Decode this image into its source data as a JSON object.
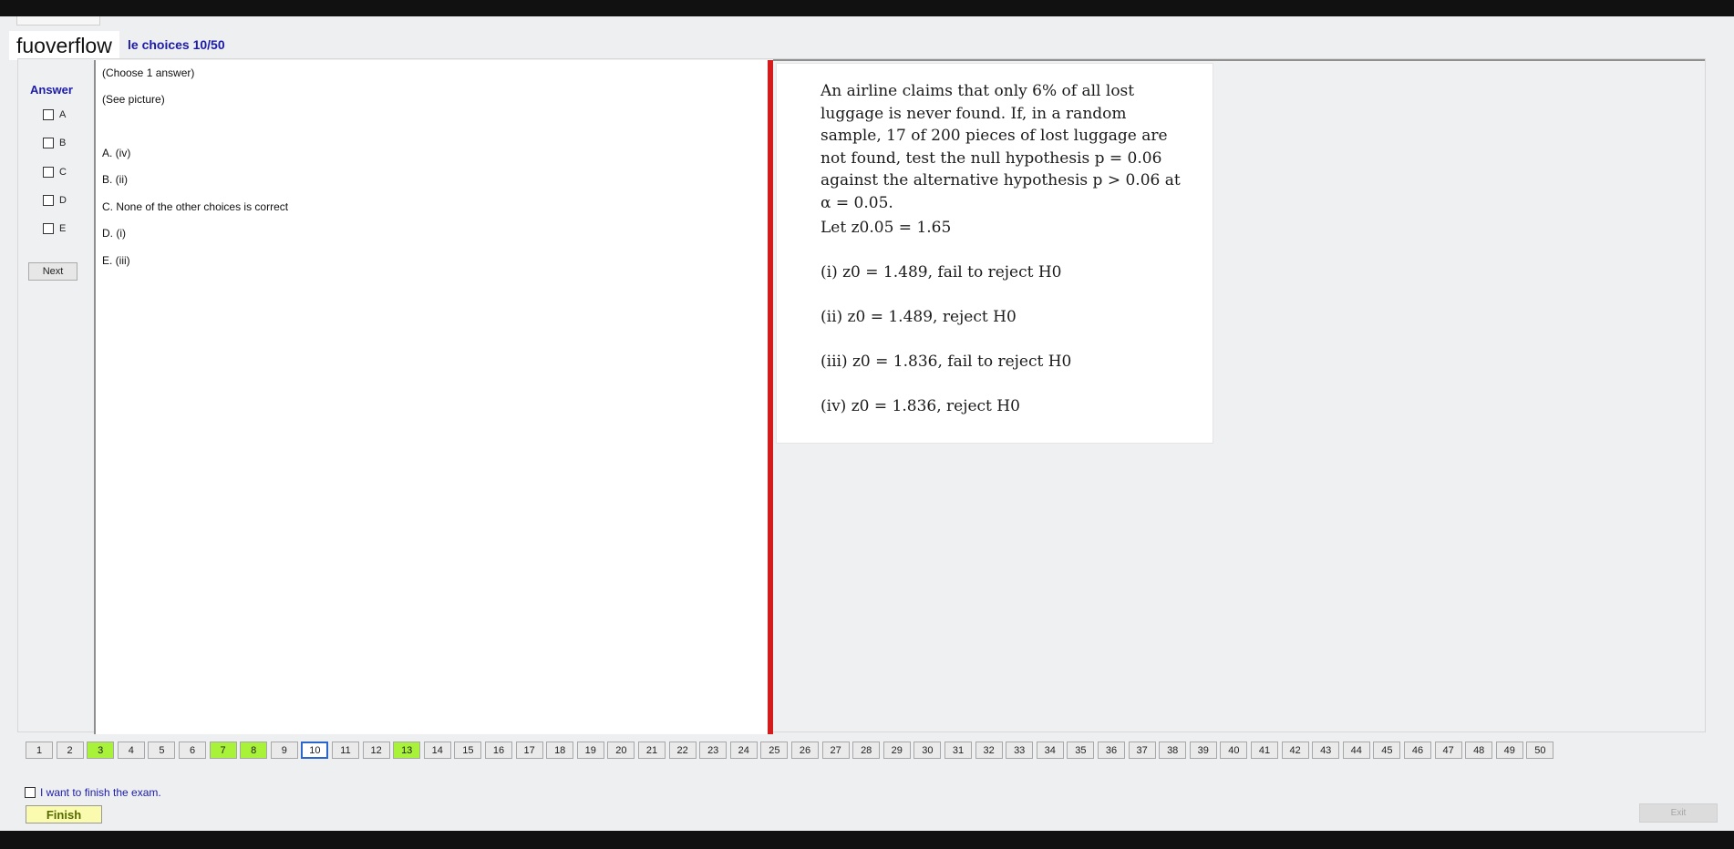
{
  "brand": {
    "logo": "fuoverflow"
  },
  "header": {
    "title": "le choices 10/50"
  },
  "answer_panel": {
    "title": "Answer",
    "options": [
      "A",
      "B",
      "C",
      "D",
      "E"
    ],
    "next_label": "Next"
  },
  "question": {
    "instruction": "(Choose 1 answer)",
    "prompt": "(See picture)",
    "choices": [
      "A.  (iv)",
      "B.  (ii)",
      "C.  None of the other choices is correct",
      "D.  (i)",
      "E.  (iii)"
    ]
  },
  "problem_image": {
    "paragraph": "An airline claims that only 6% of all lost luggage is never found. If, in a random sample, 17 of 200 pieces of lost luggage are not found, test the null hypothesis p = 0.06 against the alternative hypothesis p > 0.06 at α = 0.05.",
    "z_line": "Let z0.05 = 1.65",
    "options": [
      "(i) z0 = 1.489, fail to reject H0",
      "(ii) z0 = 1.489, reject H0",
      "(iii) z0 = 1.836, fail to reject H0",
      "(iv) z0 = 1.836, reject H0"
    ]
  },
  "navigation": {
    "total": 50,
    "current": 10,
    "answered": [
      3,
      7,
      8,
      13
    ],
    "labels": [
      "1",
      "2",
      "3",
      "4",
      "5",
      "6",
      "7",
      "8",
      "9",
      "10",
      "11",
      "12",
      "13",
      "14",
      "15",
      "16",
      "17",
      "18",
      "19",
      "20",
      "21",
      "22",
      "23",
      "24",
      "25",
      "26",
      "27",
      "28",
      "29",
      "30",
      "31",
      "32",
      "33",
      "34",
      "35",
      "36",
      "37",
      "38",
      "39",
      "40",
      "41",
      "42",
      "43",
      "44",
      "45",
      "46",
      "47",
      "48",
      "49",
      "50"
    ]
  },
  "footer": {
    "finish_check_label": "I want to finish the exam.",
    "finish_label": "Finish",
    "exit_label": "Exit"
  },
  "colors": {
    "accent_blue": "#1c1ca8",
    "divider_red": "#d41c1c",
    "answered_green": "#a9f23a",
    "finish_yellow": "#fbfbb0",
    "current_border": "#2a66cc"
  }
}
